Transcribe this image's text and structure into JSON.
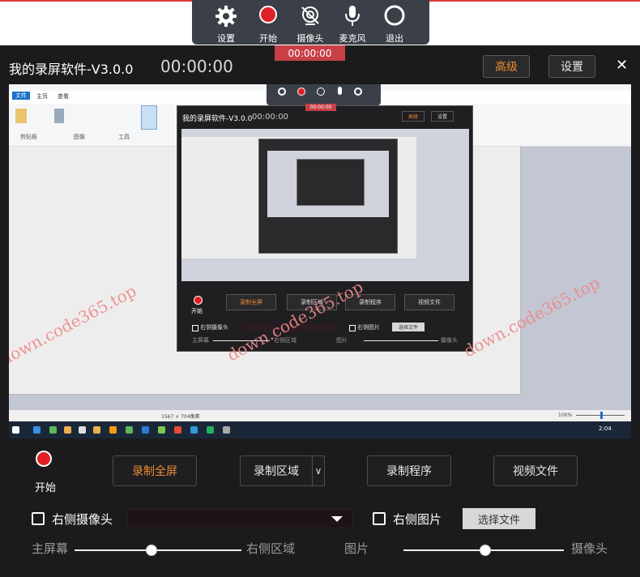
{
  "window": {
    "title": "我的录屏软件-V3.0.0",
    "timer": "00:00:00",
    "advanced_label": "高级",
    "settings_label": "设置",
    "close_glyph": "✕"
  },
  "toolbar": {
    "items": [
      {
        "label": "设置",
        "icon": "gear-icon"
      },
      {
        "label": "开始",
        "icon": "record-icon"
      },
      {
        "label": "摄像头",
        "icon": "camera-off-icon"
      },
      {
        "label": "麦克风",
        "icon": "microphone-icon"
      },
      {
        "label": "退出",
        "icon": "exit-circle-icon"
      }
    ],
    "time": "00:00:00"
  },
  "preview": {
    "paint_tabs": [
      "文件",
      "主页",
      "查看"
    ],
    "paint_groups": [
      "剪贴板",
      "图像",
      "工具"
    ],
    "statusbar": "1567 × 704像素",
    "zoom": "100%",
    "clock": "2:04",
    "nested_title": "我的录屏软件-V3.0.0",
    "nested_timer": "00:00:00",
    "nested_adv": "高级",
    "nested_set": "设置",
    "nested_buttons": [
      "录制全屏",
      "录制区域",
      "录制程序",
      "视频文件"
    ],
    "nested_start": "开始",
    "nested_opts": [
      "右侧摄像头",
      "右侧图片",
      "选择文件"
    ],
    "nested_sliders": [
      "主屏幕",
      "右侧区域",
      "图片",
      "摄像头"
    ]
  },
  "watermark": "down.code365.top",
  "controls": {
    "start_label": "开始",
    "buttons": [
      {
        "label": "录制全屏",
        "accent": true
      },
      {
        "label": "录制区域",
        "accent": false
      },
      {
        "label": "录制程序",
        "accent": false
      },
      {
        "label": "视频文件",
        "accent": false
      }
    ],
    "area_chevron": "∨",
    "right_camera_label": "右侧摄像头",
    "right_image_label": "右侧图片",
    "choose_file_label": "选择文件",
    "slider1": {
      "left": "主屏幕",
      "right": "右侧区域",
      "value": 0.46
    },
    "slider2": {
      "left": "图片",
      "right": "摄像头",
      "value": 0.51
    }
  },
  "colors": {
    "accent": "#f08a30",
    "record": "#e02020",
    "background": "#1b1b1d"
  }
}
